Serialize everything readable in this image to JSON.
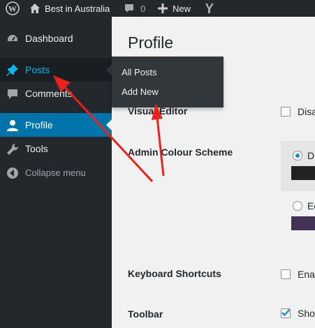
{
  "admin_bar": {
    "site_name": "Best in Australia",
    "comments_count": "0",
    "new_label": "New"
  },
  "sidebar": {
    "items": [
      {
        "label": "Dashboard",
        "icon": "dashboard-icon"
      },
      {
        "label": "Posts",
        "icon": "pushpin-icon"
      },
      {
        "label": "Comments",
        "icon": "comment-icon"
      },
      {
        "label": "Profile",
        "icon": "user-icon"
      },
      {
        "label": "Tools",
        "icon": "wrench-icon"
      },
      {
        "label": "Collapse menu",
        "icon": "collapse-icon"
      }
    ]
  },
  "flyout": {
    "items": [
      {
        "label": "All Posts"
      },
      {
        "label": "Add New"
      }
    ]
  },
  "content": {
    "title": "Profile",
    "rows": {
      "visual_editor": {
        "label": "Visual Editor",
        "option": "Disa"
      },
      "admin_colour_scheme": {
        "label": "Admin Colour Scheme",
        "options": [
          {
            "label": "D",
            "selected": true,
            "swatch": "#222222"
          },
          {
            "label": "Ec",
            "selected": false,
            "swatch": "#413256"
          }
        ]
      },
      "keyboard_shortcuts": {
        "label": "Keyboard Shortcuts",
        "option": "Enab"
      },
      "toolbar": {
        "label": "Toolbar",
        "option": "Show"
      }
    }
  },
  "colors": {
    "admin_bar": "#23282d",
    "sidebar": "#23282d",
    "current_item": "#0073aa",
    "posts_highlight": "#00b9eb",
    "annotation_arrow": "#e8231c"
  }
}
